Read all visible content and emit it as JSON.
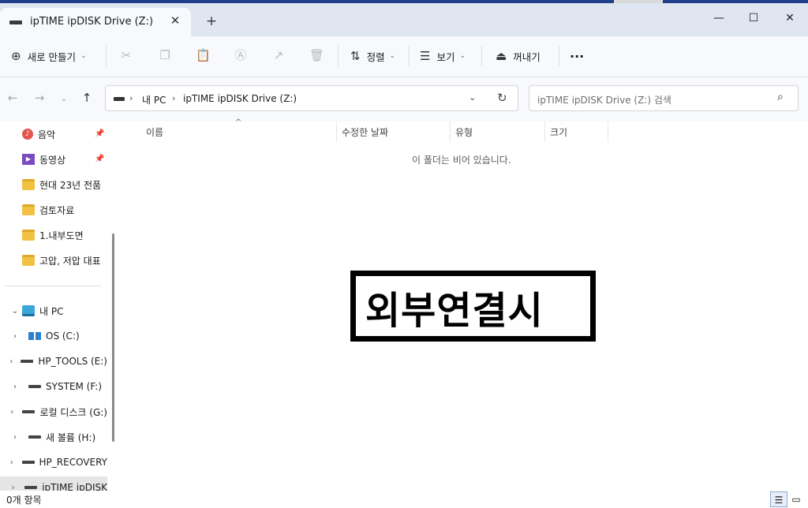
{
  "window": {
    "tab_title": "ipTIME ipDISK Drive (Z:)",
    "tab_close_glyph": "✕",
    "new_tab_glyph": "+",
    "minimize_glyph": "—",
    "maximize_glyph": "☐",
    "close_glyph": "✕"
  },
  "toolbar": {
    "new_label": "새로 만들기",
    "sort_label": "정렬",
    "view_label": "보기",
    "eject_label": "꺼내기",
    "more_glyph": "···",
    "icons": [
      "cut-icon",
      "copy-icon",
      "paste-icon",
      "rename-icon",
      "share-icon",
      "delete-icon"
    ]
  },
  "address": {
    "crumbs": [
      "내 PC",
      "ipTIME ipDISK Drive (Z:)"
    ],
    "search_placeholder": "ipTIME ipDISK Drive (Z:) 검색"
  },
  "sidebar": {
    "quick": [
      {
        "label": "음악",
        "icon": "music-icon",
        "pinned": true
      },
      {
        "label": "동영상",
        "icon": "video-icon",
        "pinned": true
      },
      {
        "label": "현대 23년 전품",
        "icon": "folder-icon",
        "pinned": false
      },
      {
        "label": "검토자료",
        "icon": "folder-icon",
        "pinned": false
      },
      {
        "label": "1.내부도면",
        "icon": "folder-icon",
        "pinned": false
      },
      {
        "label": "고압, 저압 대표",
        "icon": "folder-icon",
        "pinned": false
      }
    ],
    "pc_label": "내 PC",
    "drives": [
      {
        "label": "OS (C:)",
        "icon": "windows-drive-icon"
      },
      {
        "label": "HP_TOOLS (E:)",
        "icon": "drive-icon"
      },
      {
        "label": "SYSTEM  (F:)",
        "icon": "drive-icon"
      },
      {
        "label": "로컬 디스크 (G:)",
        "icon": "drive-icon"
      },
      {
        "label": "새 볼륨 (H:)",
        "icon": "drive-icon"
      },
      {
        "label": "HP_RECOVERY",
        "icon": "drive-icon"
      },
      {
        "label": "ipTIME ipDISK",
        "icon": "drive-icon"
      }
    ]
  },
  "columns": [
    "이름",
    "수정한 날짜",
    "유형",
    "크기"
  ],
  "empty_message": "이 폴더는 비어 있습니다.",
  "overlay_text": "외부연결시",
  "status": {
    "count": "0개 항목"
  }
}
